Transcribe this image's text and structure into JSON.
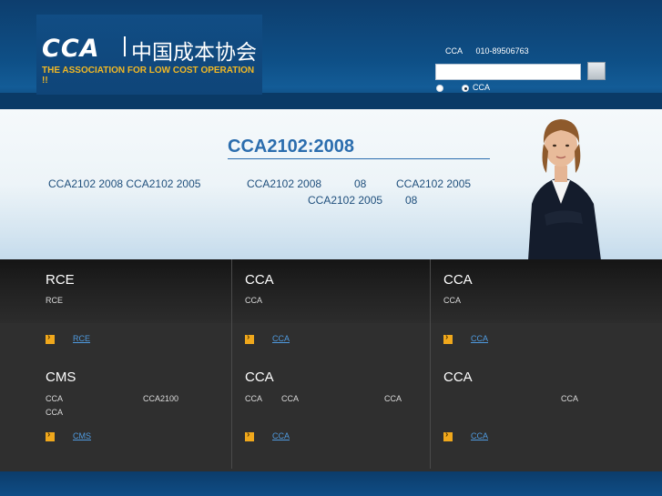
{
  "header": {
    "logo_abbr": "CCA",
    "logo_cn": "中国成本协会",
    "logo_en": "THE ASSOCIATION FOR LOW COST OPERATION !!",
    "contact_name": "CCA",
    "contact_phone": "010-89506763",
    "search_placeholder": "",
    "radio_label": "CCA"
  },
  "banner": {
    "title": "CCA2102:2008",
    "line1": [
      "CCA2102 2008 CCA2102 2005",
      "CCA2102 2008",
      "08",
      "CCA2102 2005"
    ],
    "line2": [
      "CCA2102 2005",
      "08"
    ]
  },
  "cells": [
    {
      "title": "RCE",
      "desc1": "RCE",
      "desc2": "",
      "desc3": "",
      "link": "RCE"
    },
    {
      "title": "CCA",
      "desc1": "CCA",
      "desc2": "",
      "desc3": "",
      "link": "CCA"
    },
    {
      "title": "CCA",
      "desc1": "CCA",
      "desc2": "",
      "desc3": "",
      "link": "CCA"
    },
    {
      "title": "CMS",
      "desc1": "CCA",
      "desc2": "CCA2100",
      "desc3": "CCA",
      "link": "CMS"
    },
    {
      "title": "CCA",
      "desc1": "CCA",
      "desc2": "CCA",
      "desc3": "CCA",
      "link": "CCA"
    },
    {
      "title": "CCA",
      "desc1": "CCA",
      "desc2": "",
      "desc3": "",
      "link": "CCA"
    }
  ],
  "colors": {
    "accent_blue": "#2b6dae",
    "link_blue": "#4f9be0",
    "logo_orange": "#f2b824"
  }
}
